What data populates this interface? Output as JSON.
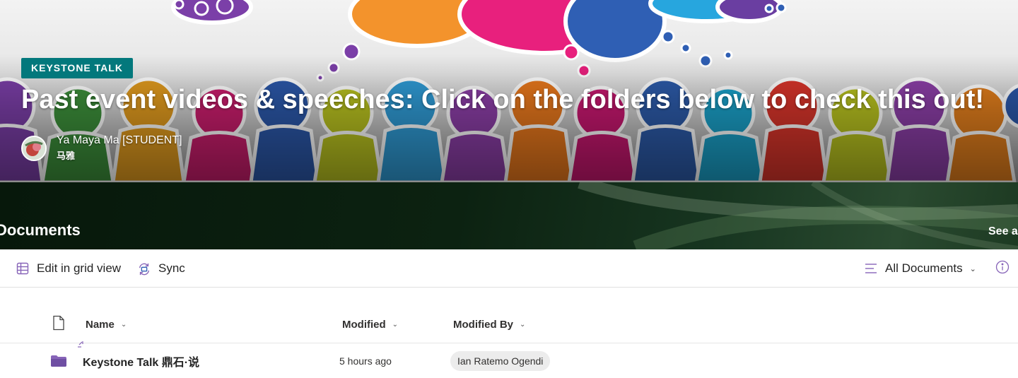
{
  "hero": {
    "topic": "KEYSTONE TALK",
    "title": "Past event videos & speeches: Click on the folders below to check this out!",
    "author": {
      "name": "Ya Maya Ma [STUDENT]",
      "sub": "马雅"
    }
  },
  "documents": {
    "title": "Documents",
    "see_all": "See a"
  },
  "toolbar": {
    "edit_grid": "Edit in grid view",
    "sync": "Sync",
    "view": "All Documents"
  },
  "list": {
    "columns": {
      "name": "Name",
      "modified": "Modified",
      "modified_by": "Modified By"
    },
    "rows": [
      {
        "name": "Keystone Talk 鼎石·说",
        "modified": "5 hours ago",
        "modified_by": "Ian Ratemo Ogendi"
      }
    ]
  },
  "colors": {
    "accent": "#03787c",
    "folder": "#8764b8",
    "toolbar_icon": "#8764b8"
  }
}
